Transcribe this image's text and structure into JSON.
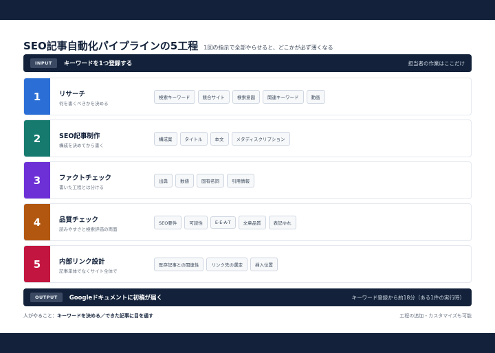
{
  "header": {
    "title": "SEO記事自動化パイプラインの5工程",
    "subtitle": "1回の指示で全部やらせると、どこかが必ず薄くなる"
  },
  "input_bar": {
    "tag": "INPUT",
    "main": "キーワードを1つ登録する",
    "note": "担当者の作業はここだけ"
  },
  "steps": [
    {
      "number": "1",
      "title": "リサーチ",
      "desc": "何を書くべきかを決める",
      "color": "#2b6fd6",
      "chips": [
        "検索キーワード",
        "競合サイト",
        "検索意図",
        "関連キーワード",
        "動画"
      ]
    },
    {
      "number": "2",
      "title": "SEO記事制作",
      "desc": "構成を決めてから書く",
      "color": "#167a6e",
      "chips": [
        "構成案",
        "タイトル",
        "本文",
        "メタディスクリプション"
      ]
    },
    {
      "number": "3",
      "title": "ファクトチェック",
      "desc": "書いた工程とは分ける",
      "color": "#6d2fd6",
      "chips": [
        "出典",
        "数値",
        "固有名詞",
        "引用情報"
      ]
    },
    {
      "number": "4",
      "title": "品質チェック",
      "desc": "読みやすさと検索評価の両面",
      "color": "#b25710",
      "chips": [
        "SEO要件",
        "可読性",
        "E-E-A-T",
        "文章品質",
        "表記ゆれ"
      ]
    },
    {
      "number": "5",
      "title": "内部リンク設計",
      "desc": "記事単体でなくサイト全体で",
      "color": "#c2153f",
      "chips": [
        "既存記事との関連性",
        "リンク先の選定",
        "挿入位置"
      ]
    }
  ],
  "output_bar": {
    "tag": "OUTPUT",
    "main": "Googleドキュメントに初稿が届く",
    "note": "キーワード登録から約18分（ある1件の実行時）"
  },
  "footer": {
    "left_prefix": "人がやること：",
    "left_bold": "キーワードを決める／できた記事に目を通す",
    "right": "工程の追加・カスタマイズも可能"
  }
}
